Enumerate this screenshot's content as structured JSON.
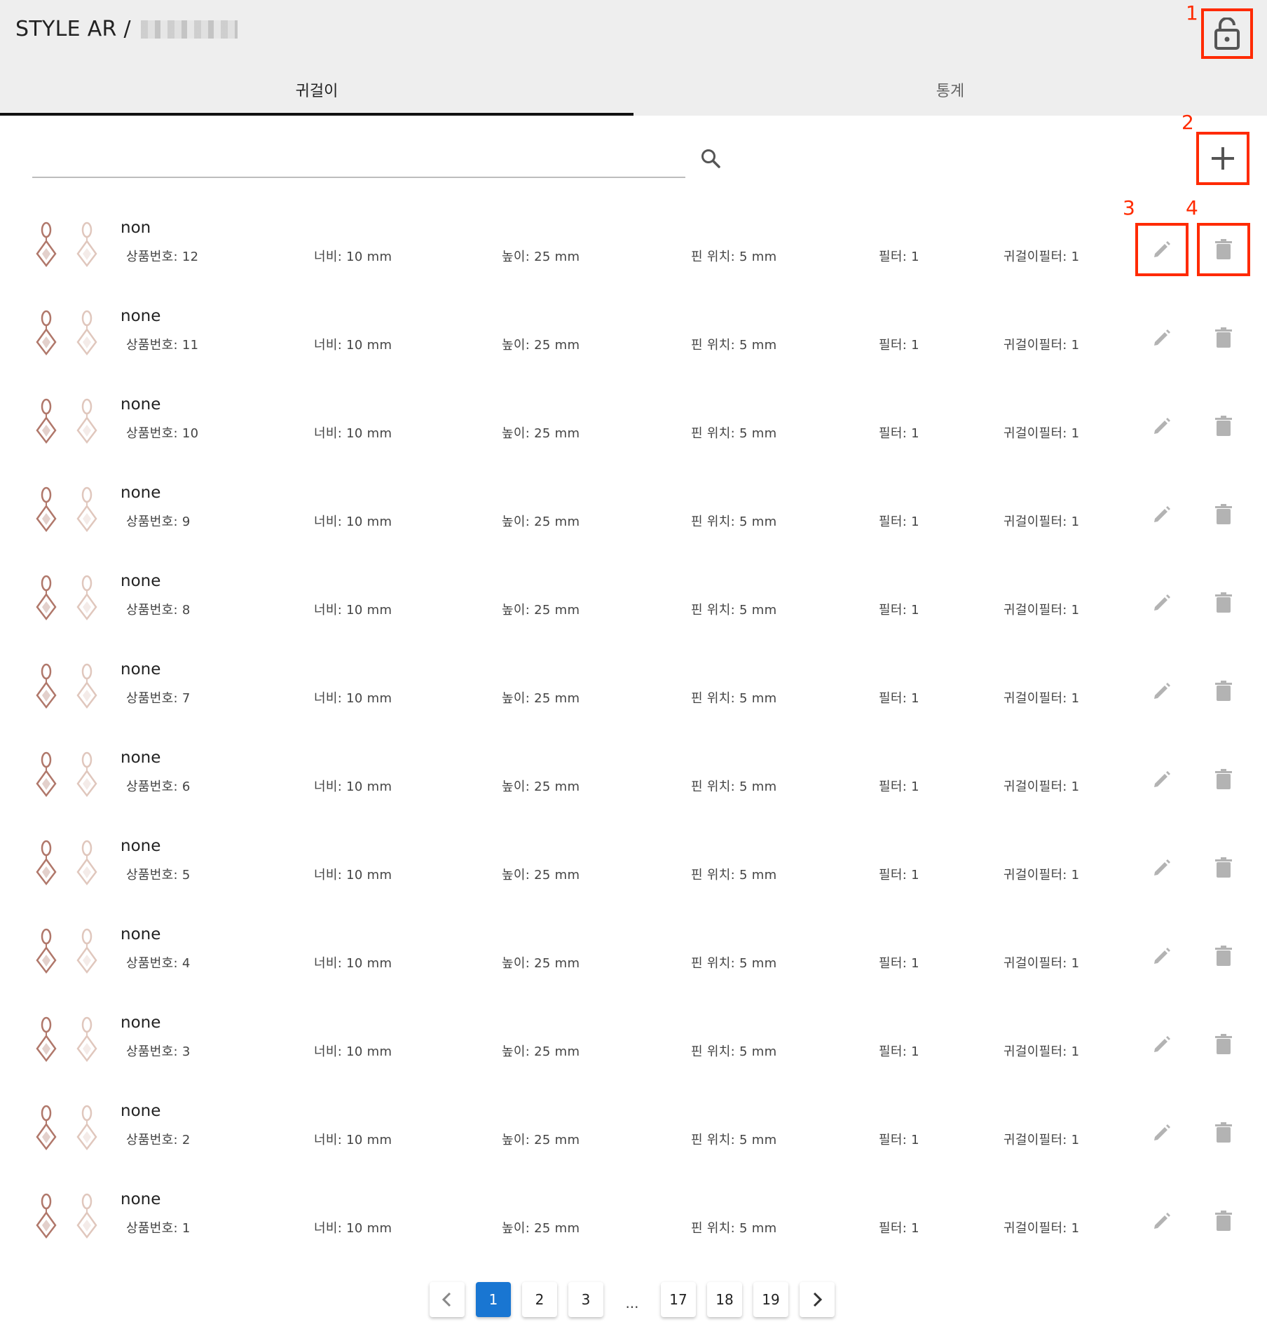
{
  "header": {
    "title": "STYLE AR /",
    "lock_icon": "lock-open-icon"
  },
  "tabs": [
    {
      "label": "귀걸이",
      "active": true
    },
    {
      "label": "통계",
      "active": false
    }
  ],
  "search": {
    "value": "",
    "placeholder": "",
    "icon": "search-icon"
  },
  "annotations": [
    "1",
    "2",
    "3",
    "4"
  ],
  "colors": {
    "annotation": "#ff2a00",
    "active_page": "#1976d2",
    "tab_indicator": "#111111"
  },
  "items": [
    {
      "name": "non",
      "product_no": "상품번호: 12",
      "width": "너비: 10 mm",
      "height": "높이: 25 mm",
      "pin": "핀 위치: 5 mm",
      "filter": "필터: 1",
      "earring_filter": "귀걸이필터: 1"
    },
    {
      "name": "none",
      "product_no": "상품번호: 11",
      "width": "너비: 10 mm",
      "height": "높이: 25 mm",
      "pin": "핀 위치: 5 mm",
      "filter": "필터: 1",
      "earring_filter": "귀걸이필터: 1"
    },
    {
      "name": "none",
      "product_no": "상품번호: 10",
      "width": "너비: 10 mm",
      "height": "높이: 25 mm",
      "pin": "핀 위치: 5 mm",
      "filter": "필터: 1",
      "earring_filter": "귀걸이필터: 1"
    },
    {
      "name": "none",
      "product_no": "상품번호: 9",
      "width": "너비: 10 mm",
      "height": "높이: 25 mm",
      "pin": "핀 위치: 5 mm",
      "filter": "필터: 1",
      "earring_filter": "귀걸이필터: 1"
    },
    {
      "name": "none",
      "product_no": "상품번호: 8",
      "width": "너비: 10 mm",
      "height": "높이: 25 mm",
      "pin": "핀 위치: 5 mm",
      "filter": "필터: 1",
      "earring_filter": "귀걸이필터: 1"
    },
    {
      "name": "none",
      "product_no": "상품번호: 7",
      "width": "너비: 10 mm",
      "height": "높이: 25 mm",
      "pin": "핀 위치: 5 mm",
      "filter": "필터: 1",
      "earring_filter": "귀걸이필터: 1"
    },
    {
      "name": "none",
      "product_no": "상품번호: 6",
      "width": "너비: 10 mm",
      "height": "높이: 25 mm",
      "pin": "핀 위치: 5 mm",
      "filter": "필터: 1",
      "earring_filter": "귀걸이필터: 1"
    },
    {
      "name": "none",
      "product_no": "상품번호: 5",
      "width": "너비: 10 mm",
      "height": "높이: 25 mm",
      "pin": "핀 위치: 5 mm",
      "filter": "필터: 1",
      "earring_filter": "귀걸이필터: 1"
    },
    {
      "name": "none",
      "product_no": "상품번호: 4",
      "width": "너비: 10 mm",
      "height": "높이: 25 mm",
      "pin": "핀 위치: 5 mm",
      "filter": "필터: 1",
      "earring_filter": "귀걸이필터: 1"
    },
    {
      "name": "none",
      "product_no": "상품번호: 3",
      "width": "너비: 10 mm",
      "height": "높이: 25 mm",
      "pin": "핀 위치: 5 mm",
      "filter": "필터: 1",
      "earring_filter": "귀걸이필터: 1"
    },
    {
      "name": "none",
      "product_no": "상품번호: 2",
      "width": "너비: 10 mm",
      "height": "높이: 25 mm",
      "pin": "핀 위치: 5 mm",
      "filter": "필터: 1",
      "earring_filter": "귀걸이필터: 1"
    },
    {
      "name": "none",
      "product_no": "상품번호: 1",
      "width": "너비: 10 mm",
      "height": "높이: 25 mm",
      "pin": "핀 위치: 5 mm",
      "filter": "필터: 1",
      "earring_filter": "귀걸이필터: 1"
    }
  ],
  "pagination": {
    "pages": [
      "1",
      "2",
      "3",
      "...",
      "17",
      "18",
      "19"
    ],
    "current": "1",
    "prev_icon": "chevron-left-icon",
    "next_icon": "chevron-right-icon"
  }
}
